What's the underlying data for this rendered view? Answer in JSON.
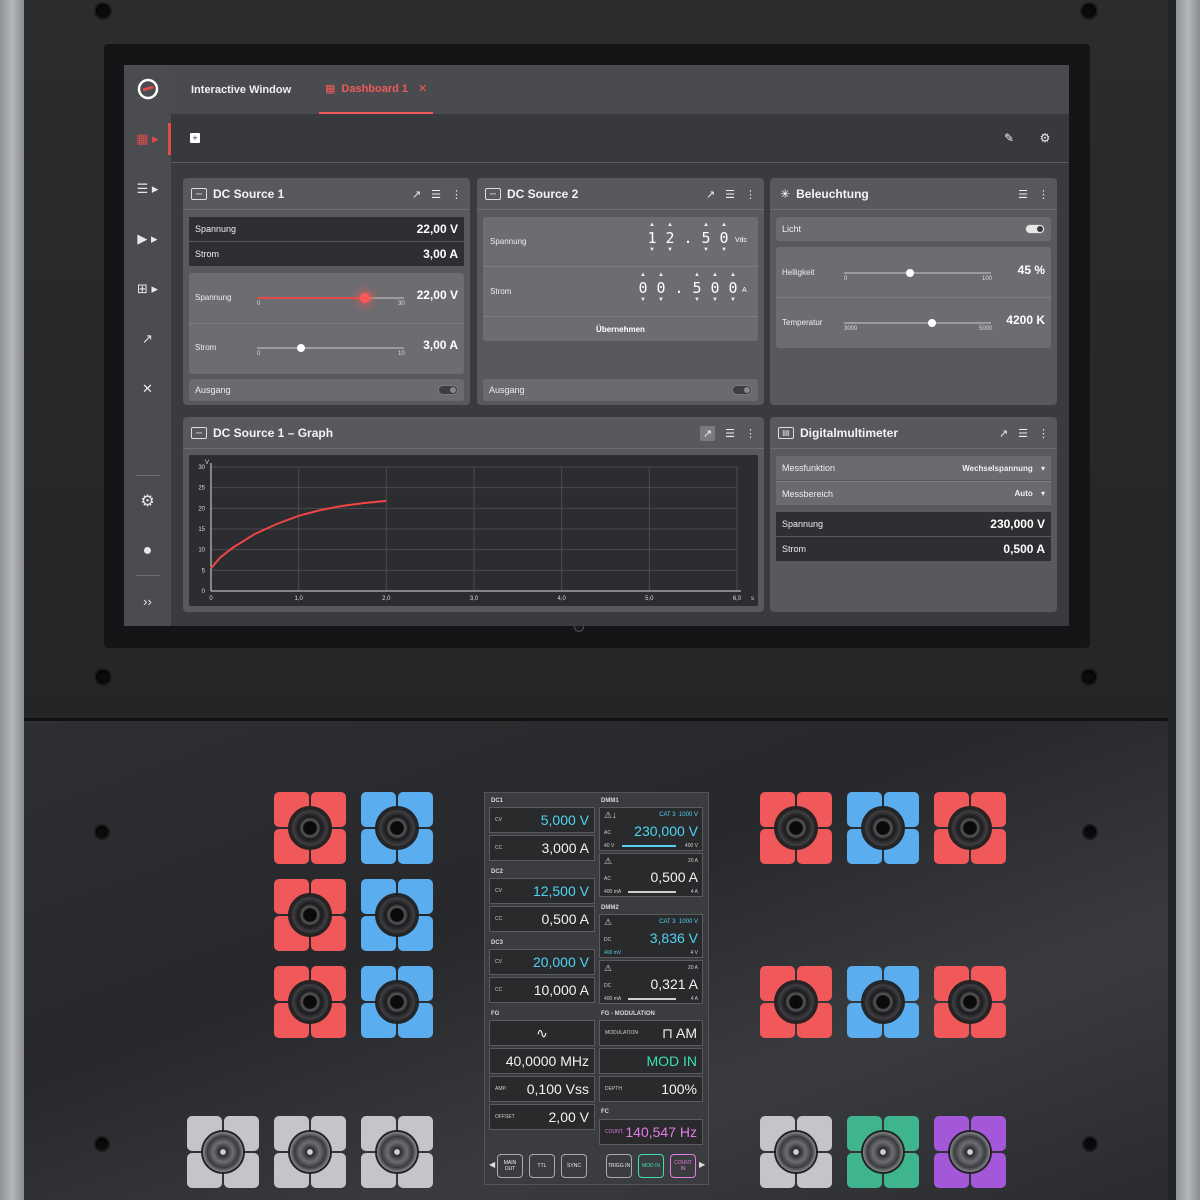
{
  "tabs": [
    {
      "label": "Interactive Window"
    },
    {
      "label": "Dashboard 1"
    }
  ],
  "dc1": {
    "title": "DC Source 1",
    "readouts": [
      {
        "label": "Spannung",
        "value": "22,00 V"
      },
      {
        "label": "Strom",
        "value": "3,00 A"
      }
    ],
    "sliders": [
      {
        "label": "Spannung",
        "value": "22,00 V",
        "min": "0",
        "max": "30",
        "level": 0.733
      },
      {
        "label": "Strom",
        "value": "3,00 A",
        "min": "0",
        "max": "10",
        "level": 0.3
      }
    ],
    "output_label": "Ausgang"
  },
  "dc2": {
    "title": "DC Source 2",
    "voltage_label": "Spannung",
    "voltage_digits": [
      "1",
      "2",
      ".",
      "5",
      "0"
    ],
    "voltage_unit": "Vdc",
    "current_label": "Strom",
    "current_digits": [
      "0",
      "0",
      ".",
      "5",
      "0",
      "0"
    ],
    "current_unit": "A",
    "apply_label": "Übernehmen",
    "output_label": "Ausgang"
  },
  "light": {
    "title": "Beleuchtung",
    "light_label": "Licht",
    "brightness": {
      "label": "Helligkeit",
      "value": "45 %",
      "min": "0",
      "max": "100",
      "level": 0.45
    },
    "temperature": {
      "label": "Temperatur",
      "value": "4200 K",
      "min": "3000",
      "max": "5000",
      "level": 0.6
    }
  },
  "graph": {
    "title": "DC Source 1 – Graph"
  },
  "chart_data": {
    "type": "line",
    "xlabel": "s",
    "ylabel": "V",
    "xlim": [
      0,
      6
    ],
    "ylim": [
      0,
      30
    ],
    "x_ticks": [
      "0",
      "1,0",
      "2,0",
      "3,0",
      "4,0",
      "5,0",
      "6,0"
    ],
    "y_ticks": [
      "0",
      "5",
      "10",
      "15",
      "20",
      "25",
      "30"
    ],
    "series": [
      {
        "x": [
          0,
          0.1,
          0.25,
          0.5,
          0.75,
          1.0,
          1.25,
          1.5,
          1.75,
          2.0
        ],
        "y": [
          5.5,
          8.0,
          10.5,
          13.8,
          16.2,
          18.2,
          19.6,
          20.6,
          21.3,
          21.8
        ]
      }
    ]
  },
  "dmm": {
    "title": "Digitalmultimeter",
    "function_label": "Messfunktion",
    "function_value": "Wechselspannung",
    "range_label": "Messbereich",
    "range_value": "Auto",
    "readouts": [
      {
        "label": "Spannung",
        "value": "230,000 V"
      },
      {
        "label": "Strom",
        "value": "0,500 A"
      }
    ]
  },
  "lcd": {
    "dc1": {
      "label": "DC1",
      "cv": "CV",
      "cv_value": "5,000 V",
      "cc": "CC",
      "cc_value": "3,000 A"
    },
    "dc2": {
      "label": "DC2",
      "cv": "CV",
      "cv_value": "12,500 V",
      "cc": "CC",
      "cc_value": "0,500 A"
    },
    "dc3": {
      "label": "DC3",
      "cv": "CV",
      "cv_value": "20,000 V",
      "cc": "CC",
      "cc_value": "10,000 A"
    },
    "dmm1": {
      "label": "DMM1",
      "cat": "CAT 3",
      "cat_v": "1000 V",
      "ac": "AC",
      "v_value": "230,000 V",
      "v_min": "40 V",
      "v_max": "400 V",
      "a_max": "20 A",
      "a_value": "0,500 A",
      "a_min": "400 mA",
      "a_max2": "4 A"
    },
    "dmm2": {
      "label": "DMM2",
      "cat": "CAT 3",
      "cat_v": "1000 V",
      "dc": "DC",
      "v_value": "3,836 V",
      "v_min": "400 mV",
      "v_max": "4 V",
      "a_max": "20 A",
      "a_value": "0,321 A",
      "a_min": "400 mA",
      "a_max2": "4 A"
    },
    "fg": {
      "label": "FG",
      "wave": "∿",
      "freq": "40,0000 MHz",
      "amp_label": "AMP.",
      "amp": "0,100 Vss",
      "offset_label": "OFFSET",
      "offset": "2,00 V"
    },
    "fgmod": {
      "label": "FG - MODULATION",
      "mod_label": "MODULATION",
      "mod_value": "AM",
      "mod_in": "MOD IN",
      "depth_label": "DEPTH",
      "depth": "100%"
    },
    "fc": {
      "label": "FC",
      "count_label": "COUNT.",
      "count": "140,547 Hz"
    },
    "buttons": [
      {
        "label": "MAIN OUT"
      },
      {
        "label": "TTL"
      },
      {
        "label": "SYNC"
      },
      {
        "label": "TRIGG IN"
      },
      {
        "label": "MOD IN"
      },
      {
        "label": "COUNT IN"
      }
    ]
  }
}
